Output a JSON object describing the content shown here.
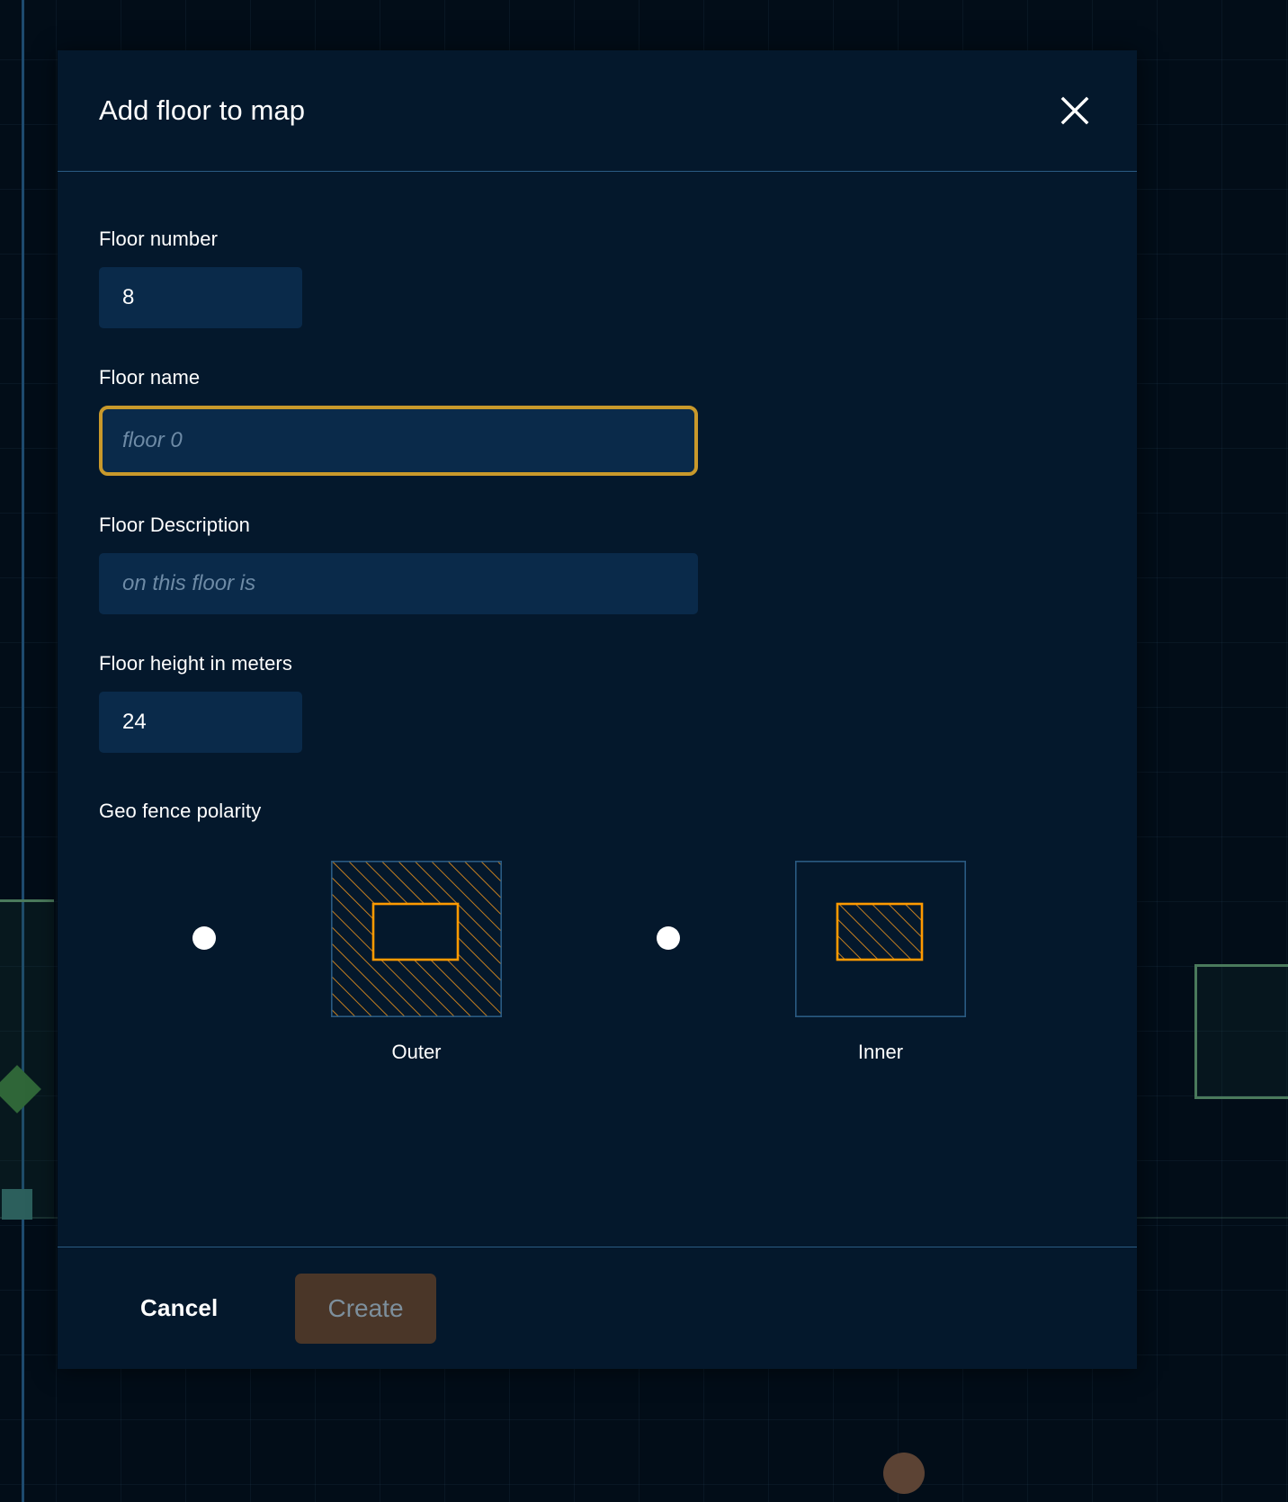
{
  "background": {
    "type": "map-canvas",
    "grid": true
  },
  "modal": {
    "title": "Add floor to map",
    "close_icon": "close-icon",
    "fields": {
      "floor_number": {
        "label": "Floor number",
        "value": "8",
        "placeholder": ""
      },
      "floor_name": {
        "label": "Floor name",
        "value": "",
        "placeholder": "floor 0",
        "focused": true,
        "focus_color": "#c9992b"
      },
      "floor_description": {
        "label": "Floor Description",
        "value": "",
        "placeholder": "on this floor is"
      },
      "floor_height": {
        "label": "Floor height in meters",
        "value": "24",
        "placeholder": ""
      }
    },
    "geo_fence": {
      "label": "Geo fence polarity",
      "options": [
        {
          "id": "outer",
          "caption": "Outer",
          "selected": false
        },
        {
          "id": "inner",
          "caption": "Inner",
          "selected": false
        }
      ],
      "hatch_color": "#d98a1f",
      "outline_color": "#ff9a00",
      "box_color": "#2a5a82"
    },
    "footer": {
      "cancel_label": "Cancel",
      "create_label": "Create",
      "create_disabled": true,
      "create_bg": "#4a3628",
      "create_text_color": "#7d8f9c"
    }
  },
  "colors": {
    "modal_bg": "#04182c",
    "input_bg": "#0a2a4a",
    "divider": "#2a5a82",
    "text": "#ffffff",
    "placeholder": "#6e8ba6"
  }
}
